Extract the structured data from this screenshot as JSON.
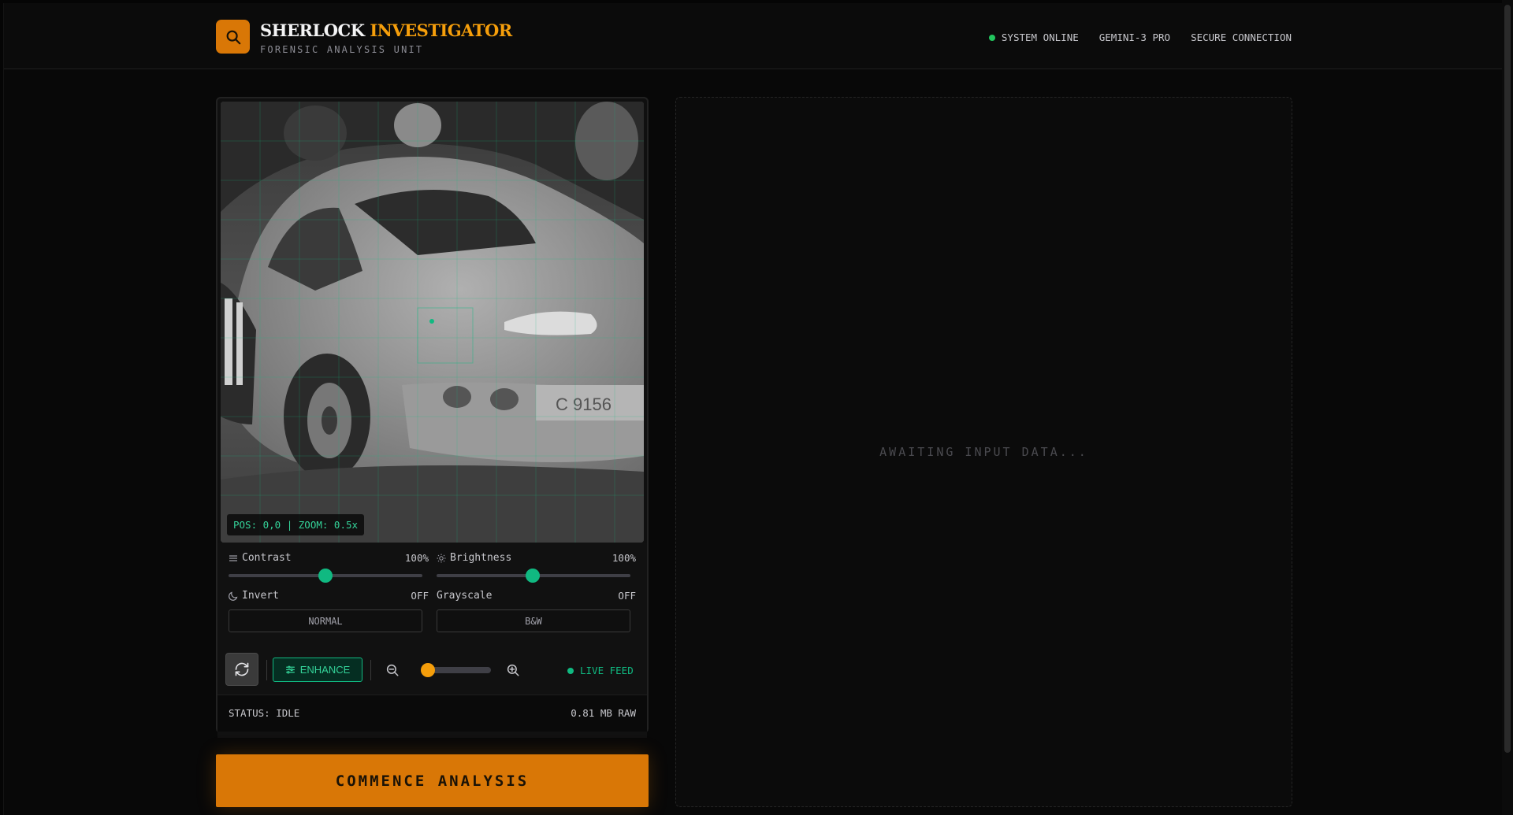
{
  "header": {
    "brand_primary": "SHERLOCK",
    "brand_accent": "INVESTIGATOR",
    "subtitle": "FORENSIC ANALYSIS UNIT",
    "logo_icon": "search-icon",
    "status_items": [
      "SYSTEM ONLINE",
      "GEMINI-3 PRO",
      "SECURE CONNECTION"
    ]
  },
  "viewer": {
    "position_readout": "POS: 0,0 | ZOOM: 0.5x"
  },
  "controls": {
    "contrast": {
      "label": "Contrast",
      "value": "100%",
      "level": 0.5
    },
    "brightness": {
      "label": "Brightness",
      "value": "100%",
      "level": 0.5
    },
    "invert": {
      "label": "Invert",
      "state": "OFF",
      "button": "NORMAL"
    },
    "grayscale": {
      "label": "Grayscale",
      "state": "OFF",
      "button": "B&W"
    },
    "enhance_label": "ENHANCE",
    "zoom_level": 0.0,
    "live_feed": "LIVE FEED"
  },
  "status": {
    "text": "STATUS: IDLE",
    "size": "0.81 MB RAW"
  },
  "actions": {
    "commence": "COMMENCE ANALYSIS"
  },
  "results": {
    "placeholder": "AWAITING INPUT DATA..."
  },
  "colors": {
    "accent": "#d97706",
    "success": "#10b981",
    "background": "#080808"
  }
}
